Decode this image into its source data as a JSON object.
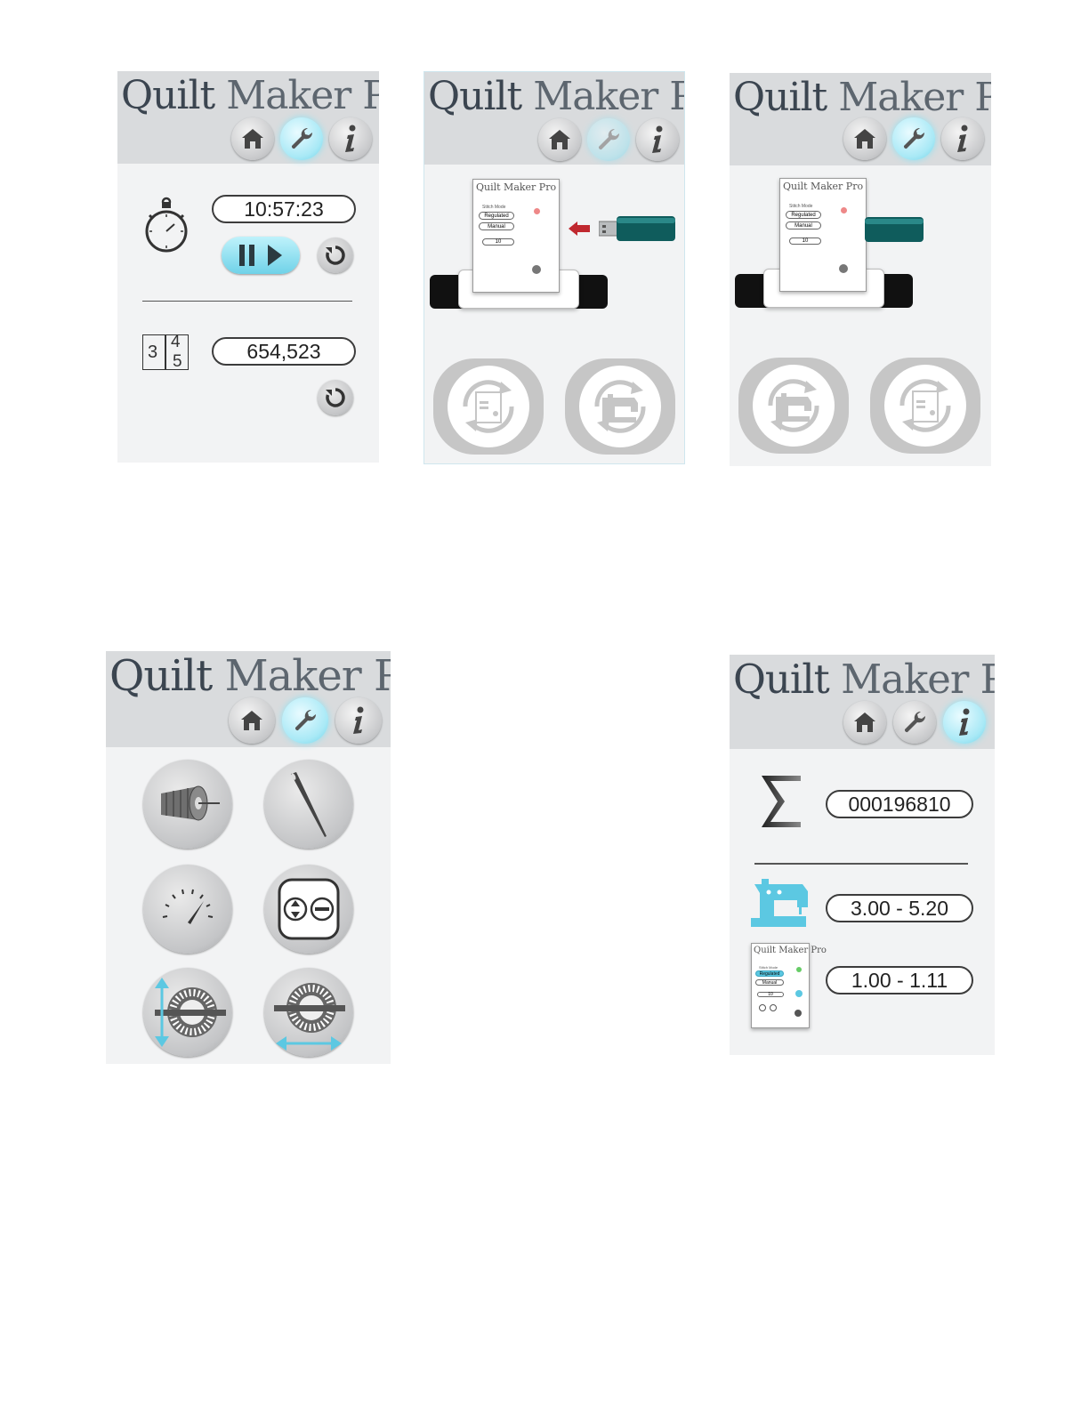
{
  "app": {
    "logo_quilt": "Quilt",
    "logo_maker_pro": "Maker Pro"
  },
  "panel_timer": {
    "timer_value": "10:57:23",
    "counter_value": "654,523",
    "counter_icon_digits": [
      "3",
      "4",
      "5"
    ]
  },
  "panel_usb_in": {
    "mini_title": "Quilt Maker Pro",
    "mini_stitch_mode": "Stitch Mode",
    "mini_regulated": "Regulated",
    "mini_manual": "Manual",
    "mini_speed": "10"
  },
  "panel_usb_out": {
    "mini_title": "Quilt Maker Pro",
    "mini_stitch_mode": "Stitch Mode",
    "mini_regulated": "Regulated",
    "mini_manual": "Manual",
    "mini_speed": "10"
  },
  "panel_maintenance": {
    "buttons": [
      "bobbin",
      "needle",
      "tension-gauge",
      "stitch-settings",
      "encoder-vertical",
      "encoder-horizontal"
    ]
  },
  "panel_info": {
    "total_stitches": "000196810",
    "machine_version": "3.00 - 5.20",
    "controller_version": "1.00 - 1.11",
    "mini_title": "Quilt Maker Pro",
    "mini_stitch_mode": "Stitch Mode",
    "mini_regulated": "Regulated",
    "mini_manual": "Manual",
    "mini_speed": "10"
  },
  "colors": {
    "header_bg": "#d9dbdd",
    "panel_bg": "#f2f3f4",
    "active_cyan": "#8fe3f3",
    "accent_blue": "#5cc8e2",
    "usb_teal": "#0f5c5c",
    "arrow_red": "#c0282f"
  }
}
